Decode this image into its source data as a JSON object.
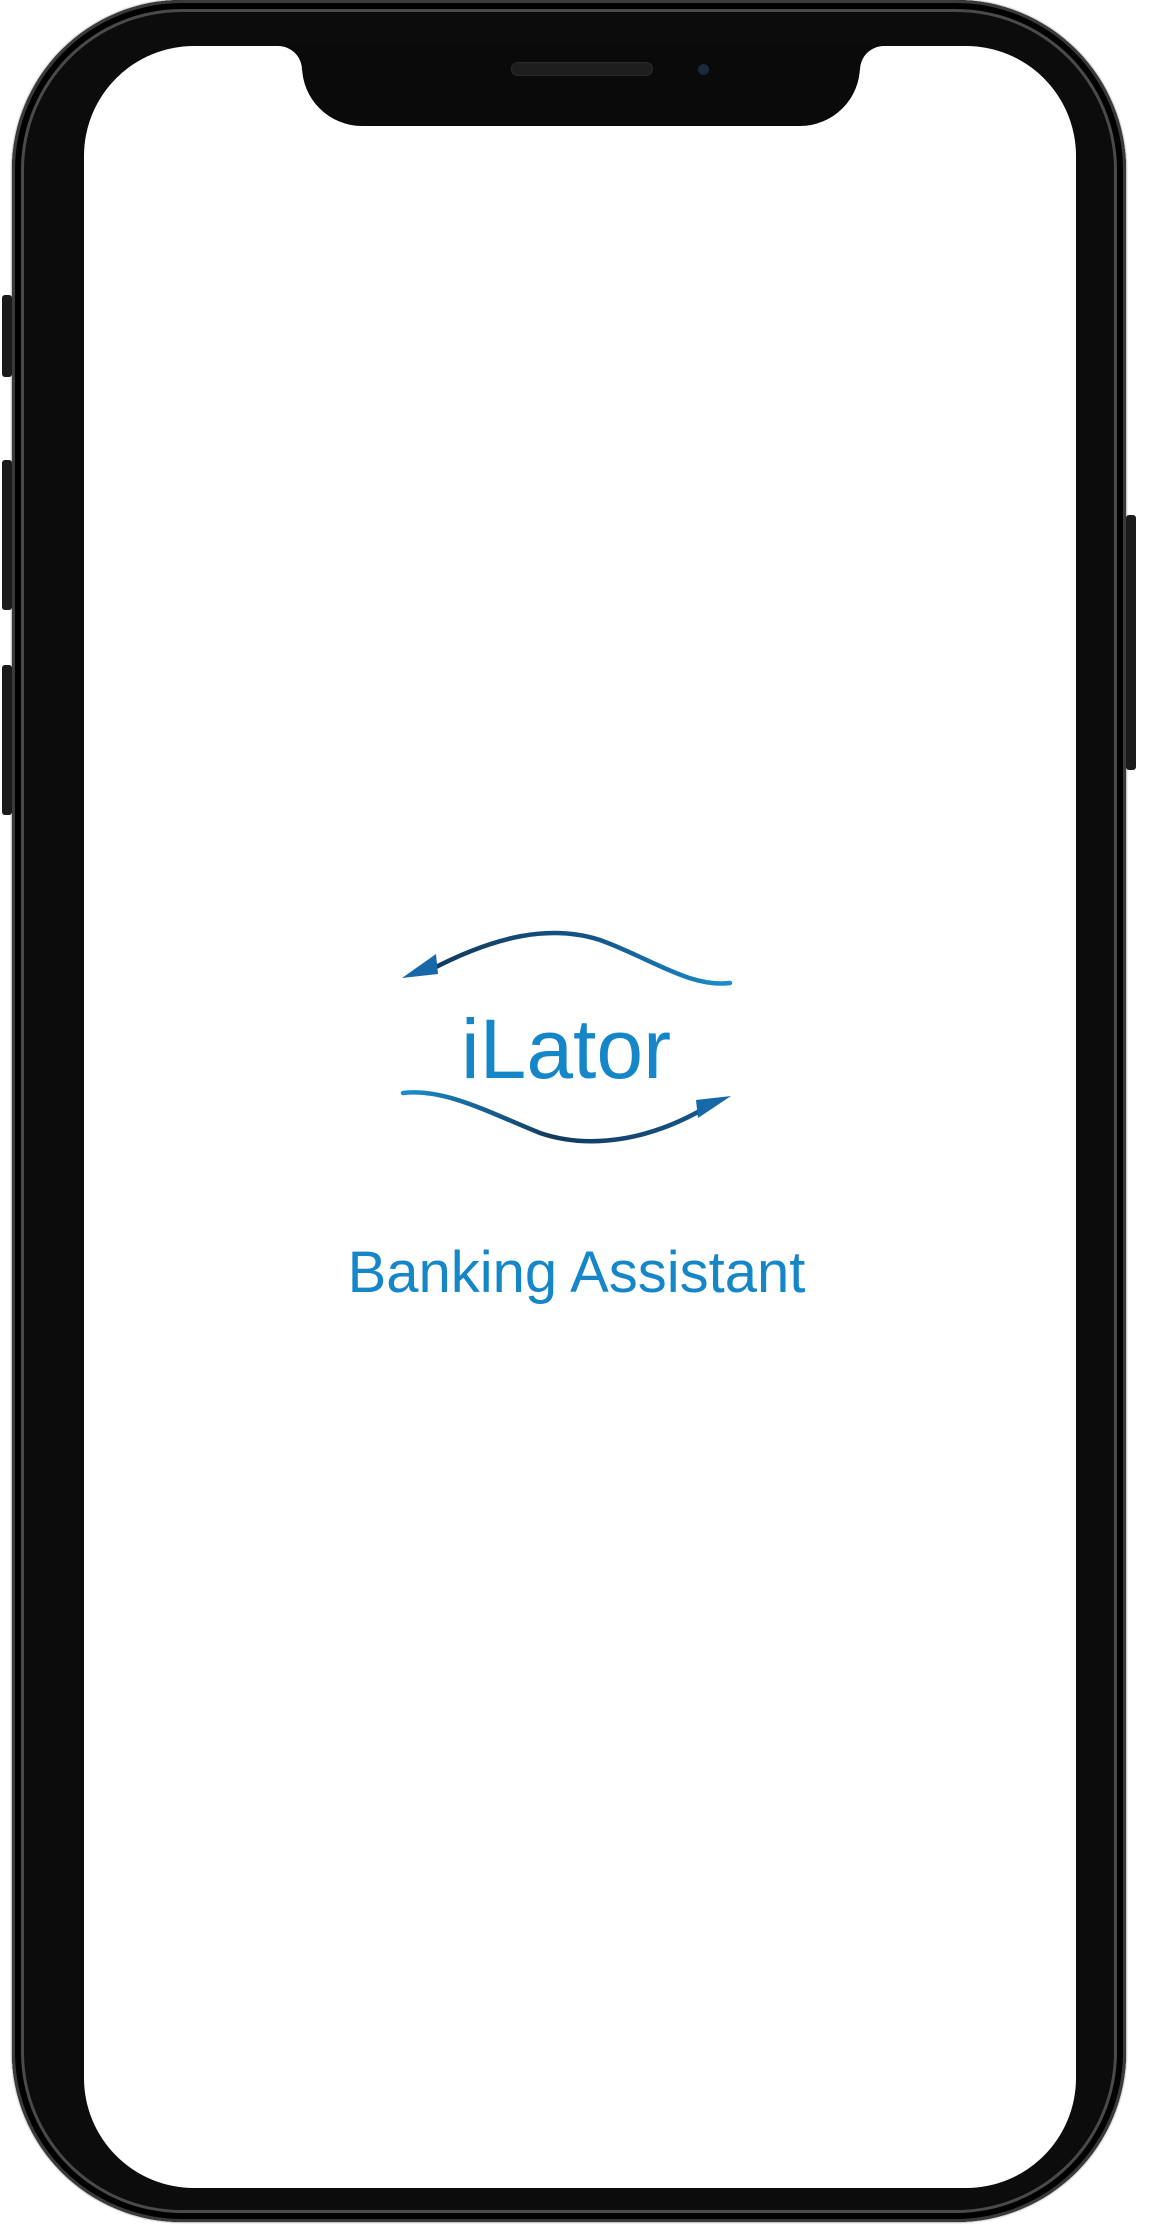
{
  "app": {
    "logo_text": "iLator",
    "tagline": "Banking Assistant"
  },
  "colors": {
    "brand": "#1586c8",
    "brand_dark": "#123a5c",
    "frame": "#0c0c0c",
    "screen": "#ffffff"
  },
  "icons": {
    "top_arrow": "curved-arrow-left-icon",
    "bottom_arrow": "curved-arrow-right-icon"
  }
}
